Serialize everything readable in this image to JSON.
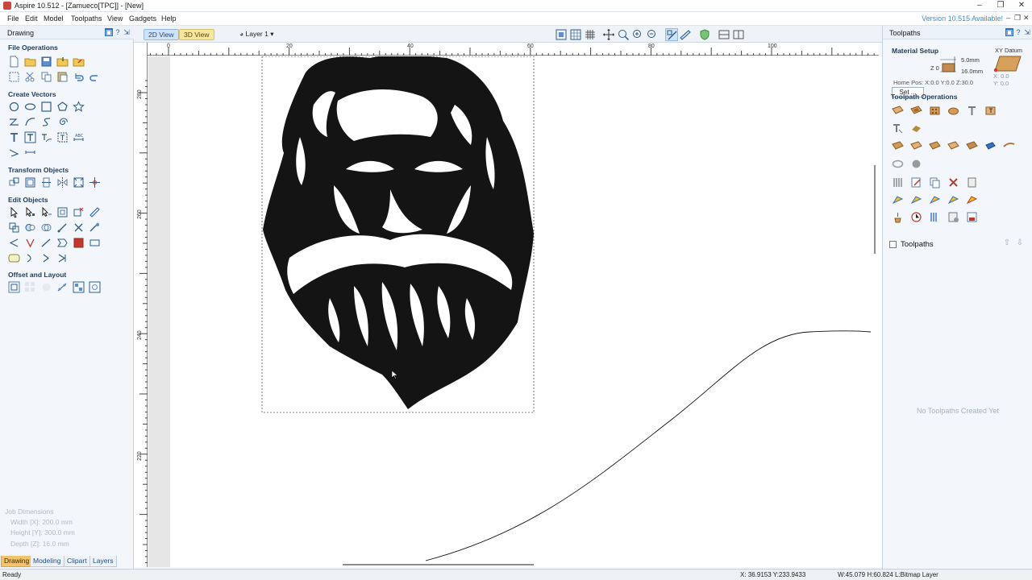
{
  "window": {
    "title": "Aspire 10.512 - [Zamueco[TPC]] - [New]",
    "controls": [
      "–",
      "❐",
      "✕"
    ]
  },
  "menubar": {
    "items": [
      "File",
      "Edit",
      "Model",
      "Toolpaths",
      "View",
      "Gadgets",
      "Help"
    ],
    "version_notice": "Version 10.515 Available!",
    "mdi_controls": [
      "–",
      "❐",
      "✕"
    ]
  },
  "left_panel": {
    "title": "Drawing",
    "header_buttons": [
      "▣",
      "?",
      "⇲"
    ],
    "sections": {
      "file_operations": "File Operations",
      "create_vectors": "Create Vectors",
      "transform_objects": "Transform Objects",
      "edit_objects": "Edit Objects",
      "offset_layout": "Offset and Layout"
    },
    "job_dimensions": {
      "title": "Job Dimensions",
      "width": "Width  [X]: 200.0 mm",
      "height": "Height [Y]: 300.0 mm",
      "depth": "Depth  [Z]: 16.0 mm"
    },
    "tabs": [
      "Drawing",
      "Modeling",
      "Clipart",
      "Layers"
    ],
    "active_tab": "Drawing"
  },
  "view": {
    "tab_2d": "2D View",
    "tab_3d": "3D View",
    "layer_label": "Layer 1",
    "top_ruler_labels": [
      "0",
      "20",
      "40",
      "60",
      "80",
      "100"
    ],
    "left_ruler_labels": [
      "280",
      "260",
      "240",
      "220"
    ]
  },
  "right_panel": {
    "title": "Toolpaths",
    "header_buttons": [
      "▣",
      "?",
      "⇲"
    ],
    "material_setup": {
      "title": "Material Setup",
      "set_button": "Set ...",
      "z_zero": "Z 0",
      "thickness_top": "5.0mm",
      "thickness_total": "16.0mm",
      "home_pos": "Home Pos:  X:0.0 Y:0.0 Z:30.0",
      "xy_datum_title": "XY Datum",
      "datum_x": "X: 0.0",
      "datum_y": "Y: 0.0"
    },
    "toolpath_operations_title": "Toolpath Operations",
    "toolpaths_list_title": "Toolpaths",
    "empty_message": "No Toolpaths Created Yet"
  },
  "statusbar": {
    "status": "Ready",
    "cursor": "X: 36.9153 Y:233.9433",
    "selection": "W:45.079  H:60.824  L:Bitmap Layer"
  },
  "colors": {
    "accent_blue": "#3a8fd6",
    "active_tab": "#f4c46a",
    "panel_bg": "#f3f7fb",
    "section_title": "#1f3b5c"
  }
}
